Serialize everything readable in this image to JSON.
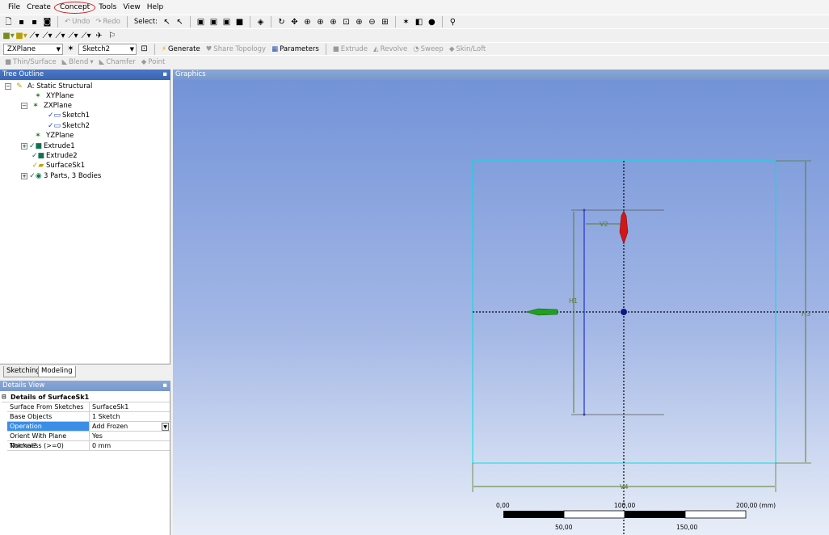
{
  "menu": [
    "File",
    "Create",
    "Concept",
    "Tools",
    "View",
    "Help"
  ],
  "toolbar1": {
    "undo": "Undo",
    "redo": "Redo",
    "select_label": "Select:"
  },
  "toolbar3": {
    "plane": "ZXPlane",
    "sketch": "Sketch2",
    "generate": "Generate",
    "share_topology": "Share Topology",
    "parameters": "Parameters",
    "extrude": "Extrude",
    "revolve": "Revolve",
    "sweep": "Sweep",
    "skin_loft": "Skin/Loft"
  },
  "toolbar4": {
    "thin_surface": "Thin/Surface",
    "blend": "Blend",
    "chamfer": "Chamfer",
    "point": "Point"
  },
  "tree": {
    "header": "Tree Outline",
    "pin": "ᵖ",
    "items": [
      {
        "label": "A: Static Structural",
        "expander": "−"
      },
      {
        "label": "XYPlane"
      },
      {
        "label": "ZXPlane",
        "expander": "−"
      },
      {
        "label": "Sketch1"
      },
      {
        "label": "Sketch2"
      },
      {
        "label": "YZPlane"
      },
      {
        "label": "Extrude1",
        "expander": "+"
      },
      {
        "label": "Extrude2"
      },
      {
        "label": "SurfaceSk1"
      },
      {
        "label": "3 Parts, 3 Bodies",
        "expander": "+"
      }
    ]
  },
  "tabs": [
    "Sketching",
    "Modeling"
  ],
  "details": {
    "header": "Details View",
    "title": "Details of SurfaceSk1",
    "rows": [
      {
        "key": "Surface From Sketches",
        "value": "SurfaceSk1"
      },
      {
        "key": "Base Objects",
        "value": "1 Sketch"
      },
      {
        "key": "Operation",
        "value": "Add Frozen"
      },
      {
        "key": "Orient With Plane Normal?",
        "value": "Yes"
      },
      {
        "key": "Thickness (>=0)",
        "value": "0 mm"
      }
    ]
  },
  "graphics": {
    "header": "Graphics",
    "dims": {
      "v2": "V2",
      "h1": "H1",
      "h3": "H3",
      "v4": "V4"
    },
    "scale": {
      "top_labels": [
        "0,00",
        "100,00",
        "200,00 (mm)"
      ],
      "bottom_labels": [
        "50,00",
        "150,00"
      ]
    }
  },
  "colors": {
    "panel_header": "#3a64b0",
    "selection": "#3a8ee6",
    "sketch_line": "#2a3ad0",
    "construction": "#00e0e0",
    "dimension": "#5a7a2a"
  }
}
